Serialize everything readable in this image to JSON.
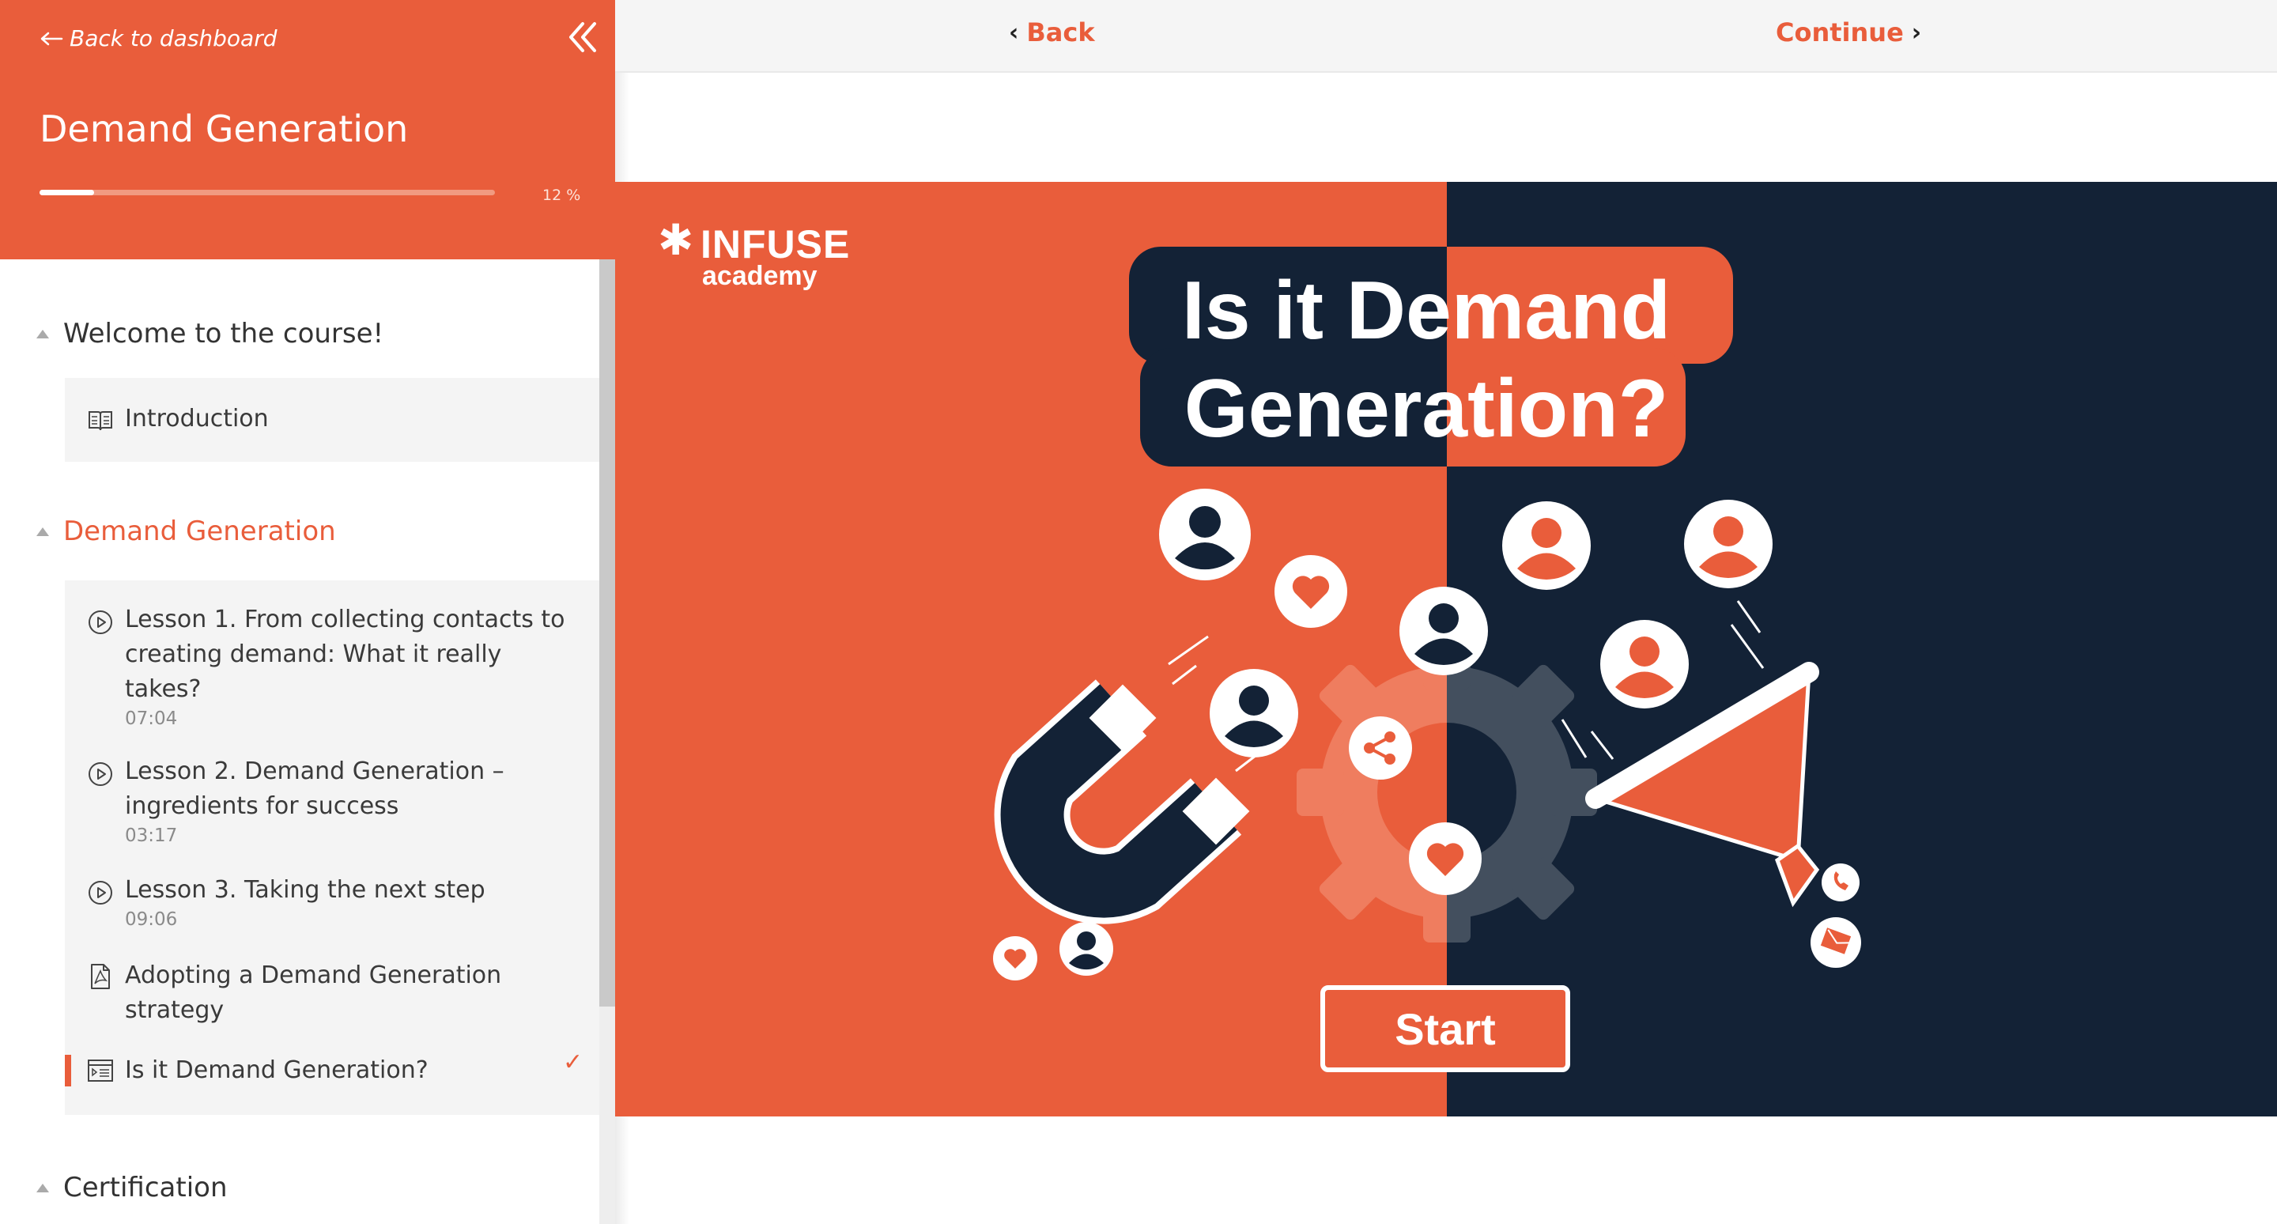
{
  "sidebar": {
    "back_label": "Back to dashboard",
    "course_title": "Demand Generation",
    "progress": {
      "percent_label": "12 %",
      "fraction": 0.12
    },
    "sections": [
      {
        "title": "Welcome to the course!",
        "lessons": [
          {
            "title": "Introduction",
            "icon": "book-icon"
          }
        ]
      },
      {
        "title": "Demand Generation",
        "lessons": [
          {
            "title": "Lesson 1. From collecting contacts to creating demand: What it really takes?",
            "duration": "07:04",
            "icon": "play-circle-icon"
          },
          {
            "title": "Lesson 2. Demand Generation – ingredients for success",
            "duration": "03:17",
            "icon": "play-circle-icon"
          },
          {
            "title": "Lesson 3. Taking the next step",
            "duration": "09:06",
            "icon": "play-circle-icon"
          },
          {
            "title": "Adopting a Demand Generation strategy",
            "icon": "pdf-icon"
          },
          {
            "title": "Is it Demand Generation?",
            "icon": "interactive-icon",
            "completed_mark": "✓"
          }
        ]
      },
      {
        "title": "Certification",
        "lessons": []
      }
    ]
  },
  "topnav": {
    "back_label": "Back",
    "continue_label": "Continue"
  },
  "hero": {
    "brand_main": "INFUSE",
    "brand_sub": "academy",
    "headline_line1": "Is it Demand",
    "headline_line2": "Generation?",
    "start_label": "Start"
  },
  "colors": {
    "accent": "#e95d3b",
    "navy": "#132236",
    "panel": "#f4f4f4"
  }
}
